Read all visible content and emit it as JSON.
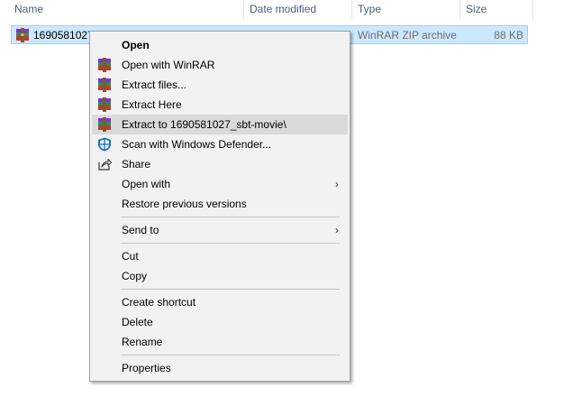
{
  "columns": {
    "name": "Name",
    "date_modified": "Date modified",
    "type": "Type",
    "size": "Size"
  },
  "file": {
    "name": "1690581027_",
    "type": "WinRAR ZIP archive",
    "size": "88 KB",
    "icon": "winrar-archive-icon"
  },
  "menu": {
    "open": "Open",
    "open_with_winrar": "Open with WinRAR",
    "extract_files": "Extract files...",
    "extract_here": "Extract Here",
    "extract_to": "Extract to 1690581027_sbt-movie\\",
    "scan_defender": "Scan with Windows Defender...",
    "share": "Share",
    "open_with": "Open with",
    "restore_versions": "Restore previous versions",
    "send_to": "Send to",
    "cut": "Cut",
    "copy": "Copy",
    "create_shortcut": "Create shortcut",
    "delete": "Delete",
    "rename": "Rename",
    "properties": "Properties",
    "submenu_arrow": "›"
  },
  "colors": {
    "selection": "#cce8ff",
    "menu_background": "#f2f2f2",
    "menu_hover": "#dadada"
  }
}
